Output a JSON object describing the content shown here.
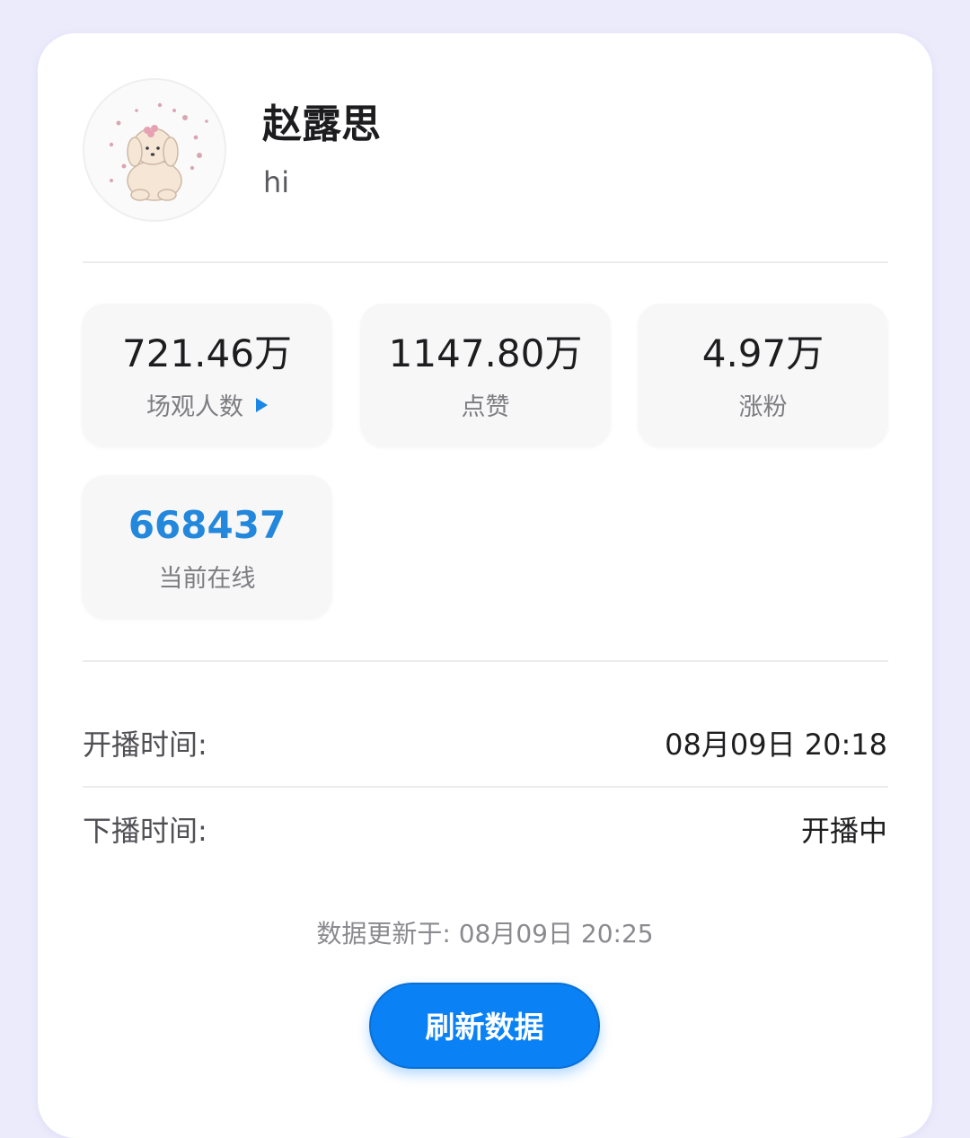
{
  "profile": {
    "name": "赵露思",
    "bio": "hi",
    "avatar": "avatar-dog-illustration"
  },
  "stats": [
    {
      "value": "721.46万",
      "label": "场观人数",
      "icon": "play-triangle-icon",
      "accent": false
    },
    {
      "value": "1147.80万",
      "label": "点赞",
      "accent": false
    },
    {
      "value": "4.97万",
      "label": "涨粉",
      "accent": false
    },
    {
      "value": "668437",
      "label": "当前在线",
      "accent": true
    }
  ],
  "broadcast": {
    "start_label": "开播时间:",
    "start_value": "08月09日 20:18",
    "end_label": "下播时间:",
    "end_value": "开播中"
  },
  "footer": {
    "updated_text": "数据更新于: 08月09日 20:25",
    "refresh_label": "刷新数据"
  },
  "colors": {
    "page_background": "#ecebfb",
    "accent_blue": "#2388dc",
    "button_blue": "#0a82f5"
  }
}
